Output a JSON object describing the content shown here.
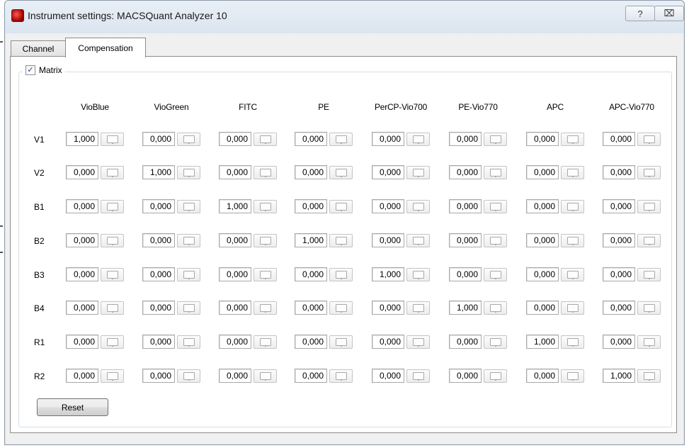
{
  "window": {
    "title": "Instrument settings: MACSQuant Analyzer 10"
  },
  "titlebar_buttons": {
    "help": "?",
    "close": "⌧"
  },
  "tabs": [
    {
      "label": "Channel",
      "selected": false
    },
    {
      "label": "Compensation",
      "selected": true
    }
  ],
  "matrix": {
    "label": "Matrix",
    "checked": true,
    "columns": [
      "VioBlue",
      "VioGreen",
      "FITC",
      "PE",
      "PerCP-Vio700",
      "PE-Vio770",
      "APC",
      "APC-Vio770"
    ],
    "rows": [
      {
        "label": "V1",
        "values": [
          "1,000",
          "0,000",
          "0,000",
          "0,000",
          "0,000",
          "0,000",
          "0,000",
          "0,000"
        ]
      },
      {
        "label": "V2",
        "values": [
          "0,000",
          "1,000",
          "0,000",
          "0,000",
          "0,000",
          "0,000",
          "0,000",
          "0,000"
        ]
      },
      {
        "label": "B1",
        "values": [
          "0,000",
          "0,000",
          "1,000",
          "0,000",
          "0,000",
          "0,000",
          "0,000",
          "0,000"
        ]
      },
      {
        "label": "B2",
        "values": [
          "0,000",
          "0,000",
          "0,000",
          "1,000",
          "0,000",
          "0,000",
          "0,000",
          "0,000"
        ]
      },
      {
        "label": "B3",
        "values": [
          "0,000",
          "0,000",
          "0,000",
          "0,000",
          "1,000",
          "0,000",
          "0,000",
          "0,000"
        ]
      },
      {
        "label": "B4",
        "values": [
          "0,000",
          "0,000",
          "0,000",
          "0,000",
          "0,000",
          "1,000",
          "0,000",
          "0,000"
        ]
      },
      {
        "label": "R1",
        "values": [
          "0,000",
          "0,000",
          "0,000",
          "0,000",
          "0,000",
          "0,000",
          "1,000",
          "0,000"
        ]
      },
      {
        "label": "R2",
        "values": [
          "0,000",
          "0,000",
          "0,000",
          "0,000",
          "0,000",
          "0,000",
          "0,000",
          "1,000"
        ]
      }
    ]
  },
  "reset_label": "Reset"
}
